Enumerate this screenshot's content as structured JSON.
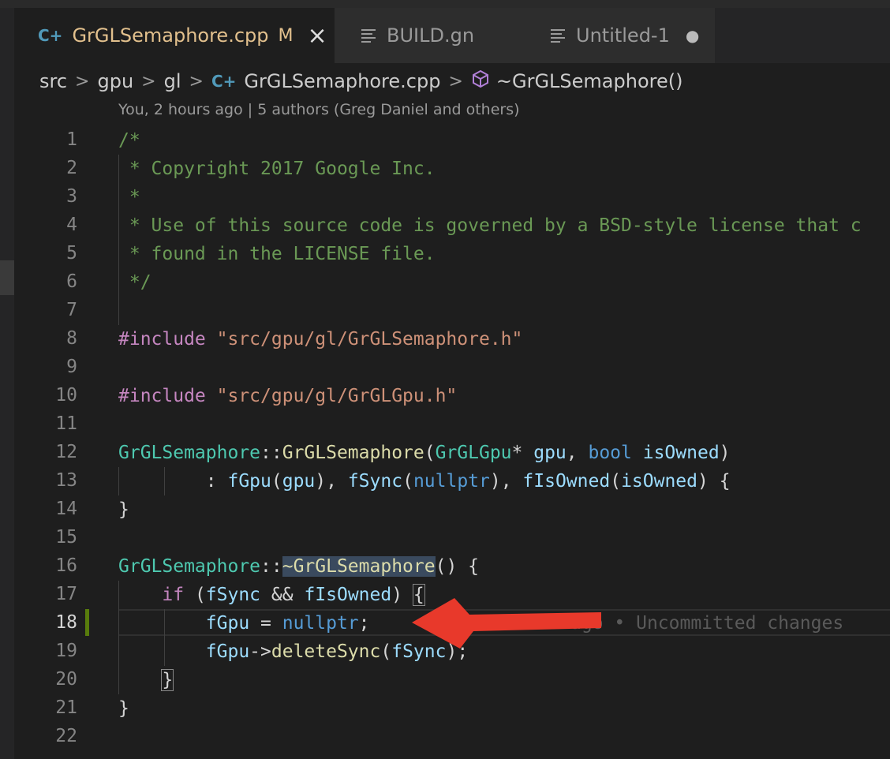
{
  "tabs": [
    {
      "label": "GrGLSemaphore.cpp",
      "icon": "cpp-file-icon",
      "badge": "M",
      "close": "×",
      "active": true
    },
    {
      "label": "BUILD.gn",
      "icon": "text-lines-icon",
      "active": false
    },
    {
      "label": "Untitled-1",
      "icon": "text-lines-icon",
      "dirty": "●",
      "active": false
    }
  ],
  "breadcrumb": {
    "items": [
      "src",
      "gpu",
      "gl",
      "GrGLSemaphore.cpp",
      "~GrGLSemaphore()"
    ],
    "separator": ">"
  },
  "codelens": "You, 2 hours ago | 5 authors (Greg Daniel and others)",
  "line_numbers": [
    "1",
    "2",
    "3",
    "4",
    "5",
    "6",
    "7",
    "8",
    "9",
    "10",
    "11",
    "12",
    "13",
    "14",
    "15",
    "16",
    "17",
    "18",
    "19",
    "20",
    "21",
    "22"
  ],
  "current_line": "18",
  "code": {
    "l1": "/*",
    "l2": " * Copyright 2017 Google Inc.",
    "l3": " *",
    "l4": " * Use of this source code is governed by a BSD-style license that c",
    "l5": " * found in the LICENSE file.",
    "l6": " */",
    "l8_kw": "#include",
    "l8_str": "\"src/gpu/gl/GrGLSemaphore.h\"",
    "l10_kw": "#include",
    "l10_str": "\"src/gpu/gl/GrGLGpu.h\"",
    "l12": {
      "cls": "GrGLSemaphore",
      "sep": "::",
      "fn": "GrGLSemaphore",
      "p1": "(",
      "t1": "GrGLGpu",
      "star": "* ",
      "a1": "gpu",
      "comma": ", ",
      "t2": "bool",
      "sp": " ",
      "a2": "isOwned",
      "p2": ")"
    },
    "l13": {
      "lead": "        : ",
      "m1": "fGpu",
      "o1": "(",
      "v1": "gpu",
      "c1": "), ",
      "m2": "fSync",
      "o2": "(",
      "v2": "nullptr",
      "c2": "), ",
      "m3": "fIsOwned",
      "o3": "(",
      "v3": "isOwned",
      "c3": ") {"
    },
    "l14": "}",
    "l16": {
      "cls": "GrGLSemaphore",
      "sep": "::",
      "fn": "~GrGLSemaphore",
      "rest": "() {"
    },
    "l17": {
      "lead": "    ",
      "kw": "if",
      "o": " (",
      "v1": "fSync",
      "op": " && ",
      "v2": "fIsOwned",
      "c": ") ",
      "br": "{"
    },
    "l18": {
      "lead": "        ",
      "v": "fGpu",
      "eq": " = ",
      "kw": "nullptr",
      "end": ";",
      "blame": "You, 2 hours ago • Uncommitted changes"
    },
    "l19": {
      "lead": "        ",
      "v": "fGpu",
      "arrow": "->",
      "fn": "deleteSync",
      "o": "(",
      "a": "fSync",
      "c": ");"
    },
    "l20": {
      "lead": "    ",
      "br": "}"
    },
    "l21": "}"
  },
  "annotation": {
    "icon": "red-arrow-icon",
    "color": "#e8392b"
  }
}
